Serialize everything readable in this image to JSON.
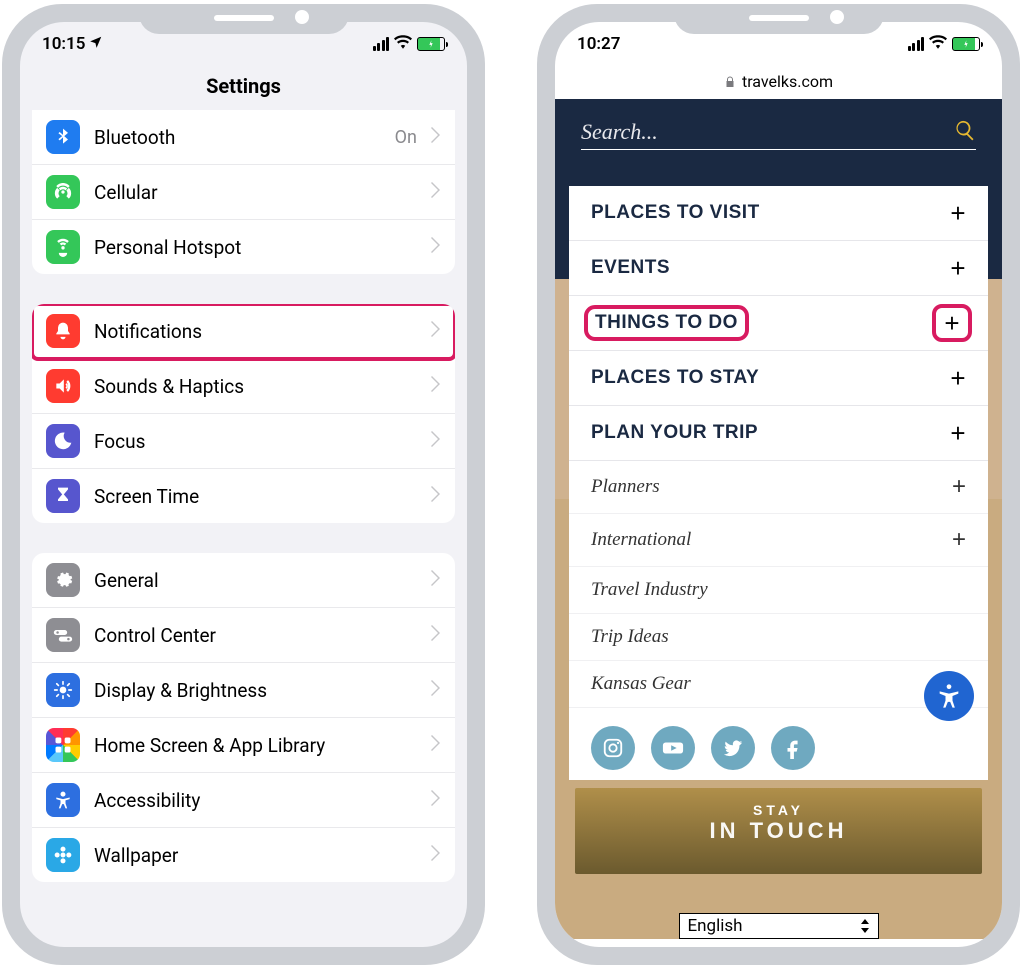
{
  "left": {
    "time": "10:15",
    "title": "Settings",
    "groups": [
      {
        "rows": [
          {
            "icon": "bluetooth-icon",
            "label": "Bluetooth",
            "detail": "On",
            "bg": "bg-blue"
          },
          {
            "icon": "cellular-icon",
            "label": "Cellular",
            "detail": "",
            "bg": "bg-green"
          },
          {
            "icon": "hotspot-icon",
            "label": "Personal Hotspot",
            "detail": "",
            "bg": "bg-green"
          }
        ]
      },
      {
        "rows": [
          {
            "icon": "bell-icon",
            "label": "Notifications",
            "detail": "",
            "bg": "bg-red",
            "highlight": true
          },
          {
            "icon": "speaker-icon",
            "label": "Sounds & Haptics",
            "detail": "",
            "bg": "bg-red"
          },
          {
            "icon": "moon-icon",
            "label": "Focus",
            "detail": "",
            "bg": "bg-indigo"
          },
          {
            "icon": "hourglass-icon",
            "label": "Screen Time",
            "detail": "",
            "bg": "bg-indigo"
          }
        ]
      },
      {
        "rows": [
          {
            "icon": "gear-icon",
            "label": "General",
            "detail": "",
            "bg": "bg-gray"
          },
          {
            "icon": "switches-icon",
            "label": "Control Center",
            "detail": "",
            "bg": "bg-gray"
          },
          {
            "icon": "brightness-icon",
            "label": "Display & Brightness",
            "detail": "",
            "bg": "bg-bluedk"
          },
          {
            "icon": "grid-icon",
            "label": "Home Screen & App Library",
            "detail": "",
            "bg": "bg-multi"
          },
          {
            "icon": "person-icon",
            "label": "Accessibility",
            "detail": "",
            "bg": "bg-bluedk"
          },
          {
            "icon": "flower-icon",
            "label": "Wallpaper",
            "detail": "",
            "bg": "bg-cyan"
          }
        ]
      }
    ]
  },
  "right": {
    "time": "10:27",
    "url": "travelks.com",
    "search_placeholder": "Search...",
    "menu": [
      {
        "label": "PLACES TO VISIT",
        "expand": true
      },
      {
        "label": "EVENTS",
        "expand": true
      },
      {
        "label": "THINGS TO DO",
        "expand": true,
        "highlight": true
      },
      {
        "label": "PLACES TO STAY",
        "expand": true
      },
      {
        "label": "PLAN YOUR TRIP",
        "expand": true
      }
    ],
    "submenu": [
      {
        "label": "Planners",
        "expand": true
      },
      {
        "label": "International",
        "expand": true
      },
      {
        "label": "Travel Industry",
        "expand": false
      },
      {
        "label": "Trip Ideas",
        "expand": false
      },
      {
        "label": "Kansas Gear",
        "expand": false
      }
    ],
    "socials": [
      "instagram",
      "youtube",
      "twitter",
      "facebook"
    ],
    "stay": {
      "l1": "STAY",
      "l2": "IN TOUCH"
    },
    "language": "English"
  }
}
